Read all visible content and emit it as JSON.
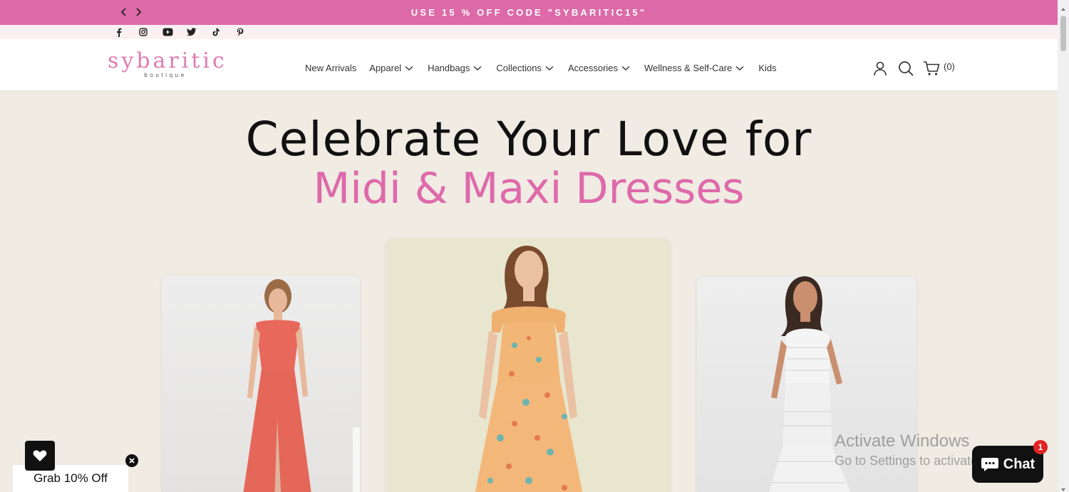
{
  "announcement": {
    "text": "USE 15 % OFF CODE \"SYBARITIC15\""
  },
  "social": [
    "facebook-icon",
    "instagram-icon",
    "youtube-icon",
    "twitter-icon",
    "tiktok-icon",
    "pinterest-icon"
  ],
  "header": {
    "logo": "sybaritic",
    "logo_sub": "boutique",
    "nav": [
      {
        "label": "New Arrivals",
        "dropdown": false
      },
      {
        "label": "Apparel",
        "dropdown": true
      },
      {
        "label": "Handbags",
        "dropdown": true
      },
      {
        "label": "Collections",
        "dropdown": true
      },
      {
        "label": "Accessories",
        "dropdown": true
      },
      {
        "label": "Wellness & Self-Care",
        "dropdown": true
      },
      {
        "label": "Kids",
        "dropdown": false
      }
    ],
    "cart_count": "(0)"
  },
  "hero": {
    "line1": "Celebrate Your Love for",
    "line2": "Midi & Maxi Dresses"
  },
  "products": [
    {
      "dress_color": "#e8685c"
    },
    {
      "dress_color": "#f0b070"
    },
    {
      "dress_color": "#f4f4f4"
    }
  ],
  "watermark": {
    "line1": "Activate Windows",
    "line2": "Go to Settings to activate Windows."
  },
  "promo": {
    "label": "Grab 10% Off"
  },
  "chat": {
    "label": "Chat",
    "badge": "1"
  },
  "colors": {
    "accent": "#dd6aa8",
    "background": "#f0ebe3"
  }
}
